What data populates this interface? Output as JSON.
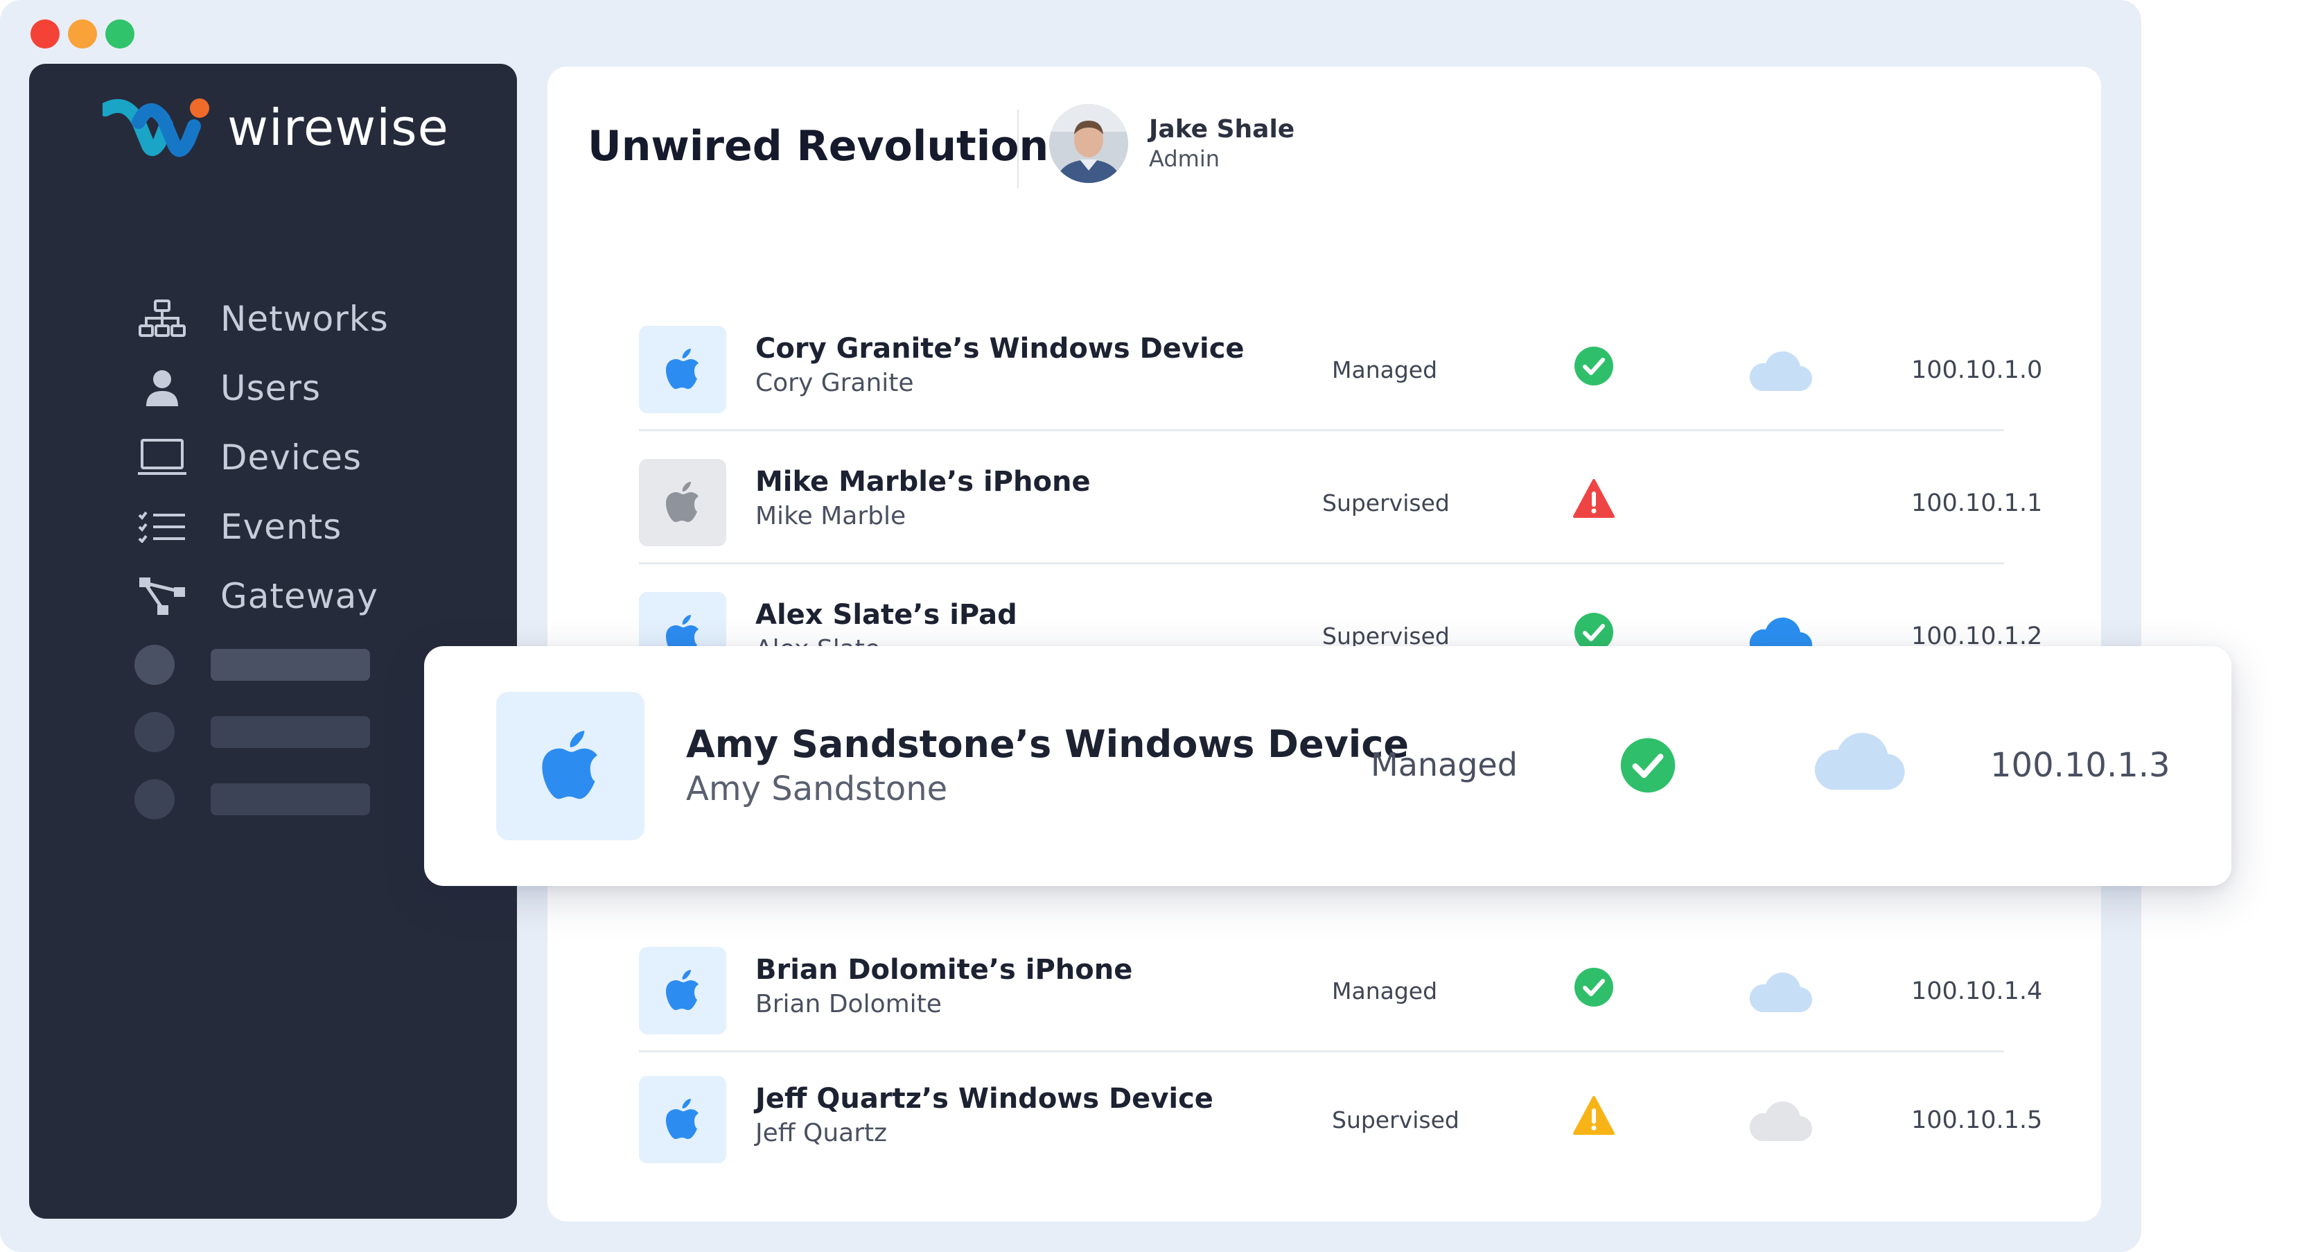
{
  "app": {
    "brand": "wirewise",
    "org_title": "Unwired Revolution"
  },
  "user": {
    "name": "Jake Shale",
    "role": "Admin"
  },
  "sidebar": {
    "items": [
      {
        "label": "Networks",
        "icon": "network-icon"
      },
      {
        "label": "Users",
        "icon": "user-icon"
      },
      {
        "label": "Devices",
        "icon": "laptop-icon"
      },
      {
        "label": "Events",
        "icon": "list-icon"
      },
      {
        "label": "Gateway",
        "icon": "gateway-icon"
      }
    ]
  },
  "devices": [
    {
      "name": "Cory Granite’s Windows Device",
      "owner": "Cory Granite",
      "type": "Managed",
      "status": "ok",
      "cloud": "light-blue",
      "ip": "100.10.1.0"
    },
    {
      "name": "Mike Marble’s iPhone",
      "owner": "Mike Marble",
      "type": "Supervised",
      "status": "error",
      "cloud": "none",
      "ip": "100.10.1.1"
    },
    {
      "name": "Alex Slate’s iPad",
      "owner": "Alex Slate",
      "type": "Supervised",
      "status": "ok",
      "cloud": "blue",
      "ip": "100.10.1.2"
    },
    {
      "name": "Amy Sandstone’s Windows Device",
      "owner": "Amy Sandstone",
      "type": "Managed",
      "status": "ok",
      "cloud": "light-blue",
      "ip": "100.10.1.3"
    },
    {
      "name": "Brian Dolomite’s iPhone",
      "owner": "Brian Dolomite",
      "type": "Managed",
      "status": "ok",
      "cloud": "light-blue",
      "ip": "100.10.1.4"
    },
    {
      "name": "Jeff Quartz’s Windows Device",
      "owner": "Jeff Quartz",
      "type": "Supervised",
      "status": "warning",
      "cloud": "gray",
      "ip": "100.10.1.5"
    }
  ],
  "colors": {
    "sidebar_bg": "#262b3b",
    "ok": "#2fbf6a",
    "error": "#ef4444",
    "warning": "#f8b417",
    "cloud_blue": "#2b8ff0",
    "cloud_light": "#c7def7",
    "cloud_gray": "#e2e4e8",
    "apple_blue": "#2d8cf0"
  }
}
